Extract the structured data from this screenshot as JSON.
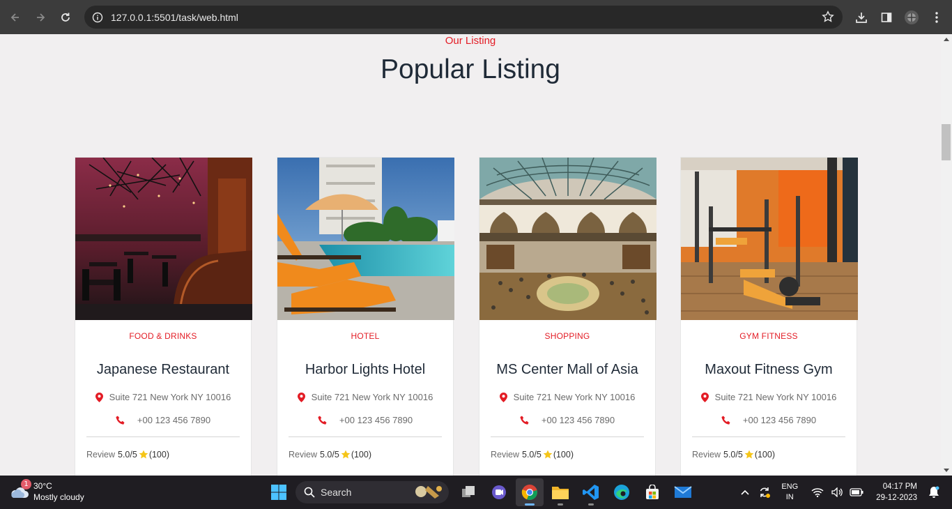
{
  "browser": {
    "url": "127.0.0.1:5501/task/web.html"
  },
  "page": {
    "eyebrow": "Our Listing",
    "heading": "Popular Listing",
    "cards": [
      {
        "category": "FOOD & DRINKS",
        "title": "Japanese Restaurant",
        "address": "Suite 721 New York NY 10016",
        "phone": "+00 123 456 7890",
        "review_label": "Review",
        "review_score": "5.0/5",
        "review_count": "(100)",
        "image": "restaurant-photo"
      },
      {
        "category": "HOTEL",
        "title": "Harbor Lights Hotel",
        "address": "Suite 721 New York NY 10016",
        "phone": "+00 123 456 7890",
        "review_label": "Review",
        "review_score": "5.0/5",
        "review_count": "(100)",
        "image": "hotel-pool-photo"
      },
      {
        "category": "SHOPPING",
        "title": "MS Center Mall of Asia",
        "address": "Suite 721 New York NY 10016",
        "phone": "+00 123 456 7890",
        "review_label": "Review",
        "review_score": "5.0/5",
        "review_count": "(100)",
        "image": "mall-photo"
      },
      {
        "category": "GYM FITNESS",
        "title": "Maxout Fitness Gym",
        "address": "Suite 721 New York NY 10016",
        "phone": "+00 123 456 7890",
        "review_label": "Review",
        "review_score": "5.0/5",
        "review_count": "(100)",
        "image": "gym-photo"
      }
    ]
  },
  "taskbar": {
    "weather_badge": "1",
    "weather_temp": "30°C",
    "weather_desc": "Mostly cloudy",
    "search_label": "Search",
    "lang_line1": "ENG",
    "lang_line2": "IN",
    "time": "04:17 PM",
    "date": "29-12-2023"
  },
  "colors": {
    "accent": "#e31c25",
    "heading": "#1f2a37",
    "chrome": "#3c3c3c",
    "taskbar": "#1f1d22"
  }
}
